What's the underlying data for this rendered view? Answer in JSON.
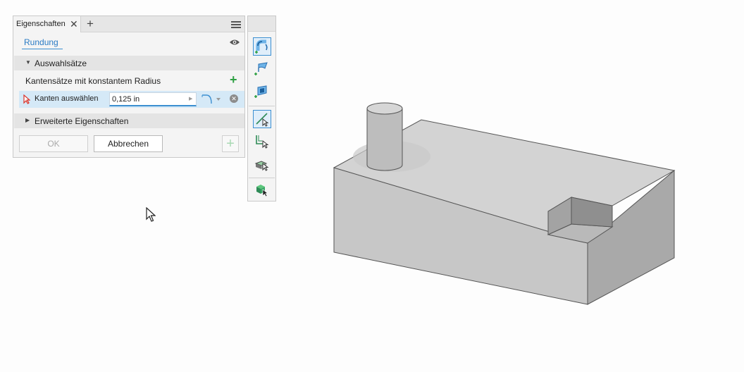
{
  "panel": {
    "tab_label": "Eigenschaften",
    "tab_close_icon": "close-icon",
    "tab_add_icon": "add-icon",
    "menu_icon": "hamburger-menu-icon",
    "feature_name": "Rundung",
    "visibility_icon": "eye-icon",
    "selection_sets": {
      "header": "Auswahlsätze",
      "expanded": true,
      "constant_radius_label": "Kantensätze mit konstantem Radius",
      "add_icon": "plus-icon",
      "edge_row": {
        "label": "Kanten auswählen",
        "radius_value": "0,125 in",
        "clear_icon": "clear-icon"
      }
    },
    "advanced": {
      "header": "Erweiterte Eigenschaften",
      "expanded": false
    },
    "buttons": {
      "ok": "OK",
      "cancel": "Abbrechen",
      "apply_icon": "plus-icon"
    }
  },
  "toolbar": {
    "tools": [
      {
        "name": "fillet-edge-tool",
        "active": true
      },
      {
        "name": "fillet-face-tool",
        "active": false
      },
      {
        "name": "fillet-full-round-tool",
        "active": false
      },
      {
        "name": "select-edge-tool",
        "active": true
      },
      {
        "name": "select-loop-tool",
        "active": false
      },
      {
        "name": "select-feature-tool",
        "active": false
      },
      {
        "name": "select-body-tool",
        "active": false
      }
    ]
  },
  "colors": {
    "accent": "#3c8fd1",
    "link": "#2a7bc4",
    "add_green": "#2ea043",
    "selection_row": "#d5e9f7",
    "model_gray": "#c6c6c6"
  }
}
